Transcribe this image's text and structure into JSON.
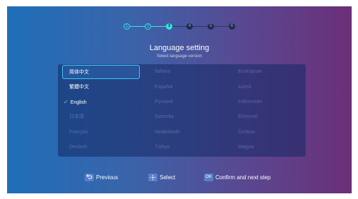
{
  "stepper": {
    "steps": [
      "1",
      "2",
      "3",
      "4",
      "5",
      "6"
    ],
    "current_step": 3
  },
  "title": "Language setting",
  "subtitle": "Select language version",
  "languages": [
    [
      "简体中文",
      "Italiano",
      "Български"
    ],
    [
      "繁體中文",
      "Español",
      "suomi"
    ],
    [
      "English",
      "Русский",
      "Indonesian"
    ],
    [
      "日本語",
      "Svenska",
      "Ελληνικά"
    ],
    [
      "Français",
      "Nederlands",
      "Čeština"
    ],
    [
      "Deutsch",
      "Türkçe",
      "Magyar"
    ]
  ],
  "checked_language": "English",
  "footer": {
    "previous_label": "Previous",
    "select_label": "Select",
    "ok_key": "OK",
    "confirm_label": "Confirm and next step"
  },
  "colors": {
    "accent": "#2ee8e0",
    "focus_border": "#3ec8f0",
    "key_bg": "#5a7ec8"
  },
  "icons": {
    "previous": "return-arrow-icon",
    "select": "dpad-icon",
    "check": "checkmark-icon"
  }
}
